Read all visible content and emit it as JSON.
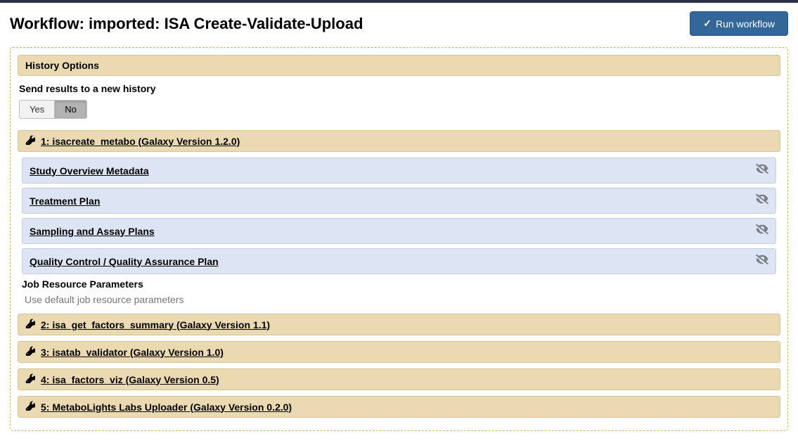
{
  "header": {
    "title": "Workflow: imported: ISA Create-Validate-Upload",
    "run_button": "Run workflow"
  },
  "history_options": {
    "header": "History Options",
    "prompt": "Send results to a new history",
    "yes": "Yes",
    "no": "No"
  },
  "steps": [
    {
      "title": "1: isacreate_metabo (Galaxy Version 1.2.0)",
      "subsections": [
        "Study Overview Metadata",
        "Treatment Plan",
        "Sampling and Assay Plans",
        "Quality Control / Quality Assurance Plan"
      ],
      "job_params_label": "Job Resource Parameters",
      "job_params_desc": "Use default job resource parameters"
    },
    {
      "title": "2: isa_get_factors_summary (Galaxy Version 1.1)"
    },
    {
      "title": "3: isatab_validator (Galaxy Version 1.0)"
    },
    {
      "title": "4: isa_factors_viz (Galaxy Version 0.5)"
    },
    {
      "title": "5: MetaboLights Labs Uploader (Galaxy Version 0.2.0)"
    }
  ]
}
